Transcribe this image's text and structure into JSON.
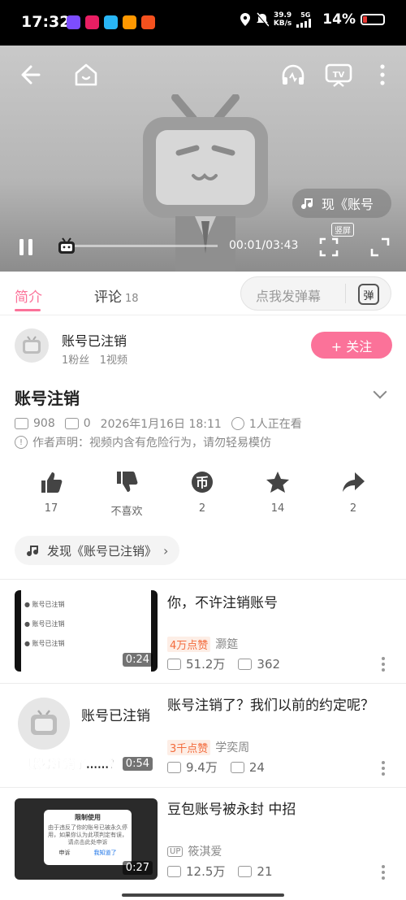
{
  "status_bar": {
    "time": "17:32",
    "net_speed_value": "39.9",
    "net_speed_unit": "KB/s",
    "network": "5G",
    "battery": "14%"
  },
  "player": {
    "title_chip": "现《账号",
    "timecode": "00:01/03:43",
    "vertical_label": "竖屏",
    "progress": 0.004
  },
  "tabs": {
    "intro": "简介",
    "comments": "评论",
    "comments_count": "18",
    "danmu_placeholder": "点我发弹幕",
    "danmu_icon": "弹"
  },
  "author": {
    "name": "账号已注销",
    "fans": "1粉丝",
    "videos": "1视频",
    "follow": "+ 关注"
  },
  "video": {
    "title": "账号注销",
    "plays": "908",
    "danmaku": "0",
    "date": "2026年1月16日 18:11",
    "watching": "1人正在看",
    "notice": "作者声明：视频内含有危险行为，请勿轻易模仿"
  },
  "actions": [
    {
      "icon": "thumbs-up-icon",
      "label": "17"
    },
    {
      "icon": "thumbs-down-icon",
      "label": "不喜欢"
    },
    {
      "icon": "coin-icon",
      "label": "2"
    },
    {
      "icon": "star-icon",
      "label": "14"
    },
    {
      "icon": "share-icon",
      "label": "2"
    }
  ],
  "music_pill": "发现《账号已注销》",
  "related": [
    {
      "title": "你，不许注销账号",
      "hot": "4万点赞",
      "author": "灏筵",
      "views": "51.2万",
      "comments": "362",
      "duration": "0:24",
      "thumb_text": "账号已注销"
    },
    {
      "title": "账号注销了？我们以前的约定呢？",
      "hot": "3千点赞",
      "author": "学奕周",
      "views": "9.4万",
      "comments": "24",
      "duration": "0:54",
      "thumb_text": "账号已注销",
      "thumb_caption": "账号注销了……？"
    },
    {
      "title": "豆包账号被永封 中招",
      "hot": "",
      "up": "UP",
      "author": "筱淇爱",
      "views": "12.5万",
      "comments": "21",
      "duration": "0:27",
      "dialog_title": "限制使用",
      "dialog_body": "由于违反了你的账号已被永久停用，如果你认为此项判定有误，请点击此处申诉",
      "dialog_left": "申诉",
      "dialog_right": "我知道了"
    }
  ],
  "colors": {
    "accent": "#fb7299",
    "hot": "#f36c3d"
  }
}
